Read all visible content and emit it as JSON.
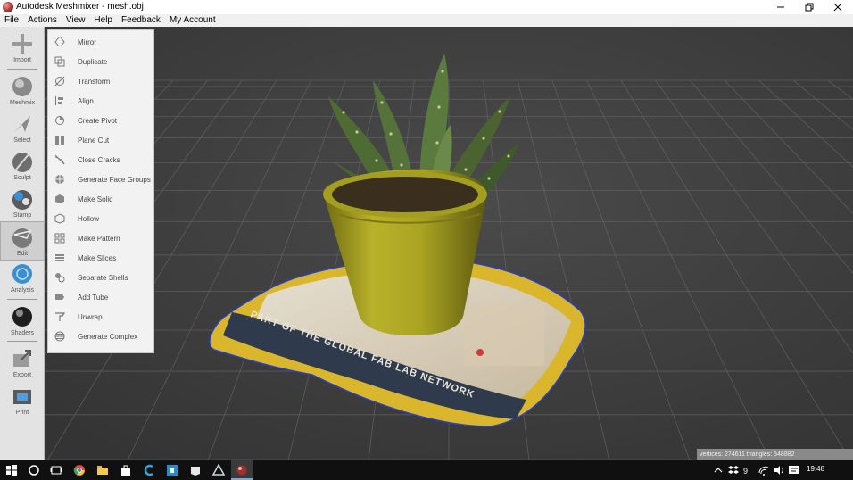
{
  "window": {
    "title": "Autodesk Meshmixer - mesh.obj"
  },
  "menubar": {
    "items": [
      "File",
      "Actions",
      "View",
      "Help",
      "Feedback",
      "My Account"
    ]
  },
  "toolbar": {
    "items": [
      {
        "label": "Import",
        "icon": "import-icon"
      },
      {
        "label": "Meshmix",
        "icon": "meshmix-icon"
      },
      {
        "label": "Select",
        "icon": "select-icon"
      },
      {
        "label": "Sculpt",
        "icon": "sculpt-icon"
      },
      {
        "label": "Stamp",
        "icon": "stamp-icon"
      },
      {
        "label": "Edit",
        "icon": "edit-icon",
        "active": true
      },
      {
        "label": "Analysis",
        "icon": "analysis-icon"
      },
      {
        "label": "Shaders",
        "icon": "shaders-icon"
      },
      {
        "label": "Export",
        "icon": "export-icon"
      },
      {
        "label": "Print",
        "icon": "print-icon"
      }
    ]
  },
  "edit_menu": {
    "items": [
      "Mirror",
      "Duplicate",
      "Transform",
      "Align",
      "Create Pivot",
      "Plane Cut",
      "Close Cracks",
      "Generate Face Groups",
      "Make Solid",
      "Hollow",
      "Make Pattern",
      "Make Slices",
      "Separate Shells",
      "Add Tube",
      "Unwrap",
      "Generate Complex"
    ]
  },
  "status": {
    "text": "vertices: 274611 triangles: 548882"
  },
  "taskbar": {
    "clock": "19:48"
  },
  "colors": {
    "viewport_bg": "#404040",
    "toolbar_bg": "#e3e3e3",
    "menu_bg": "#f2f2f2",
    "pot": "#b8b22a",
    "mat_yellow": "#e8c22c",
    "mat_dark": "#2f3a4d",
    "leaf": "#4f6b34",
    "selection_outline": "#2840c8"
  }
}
